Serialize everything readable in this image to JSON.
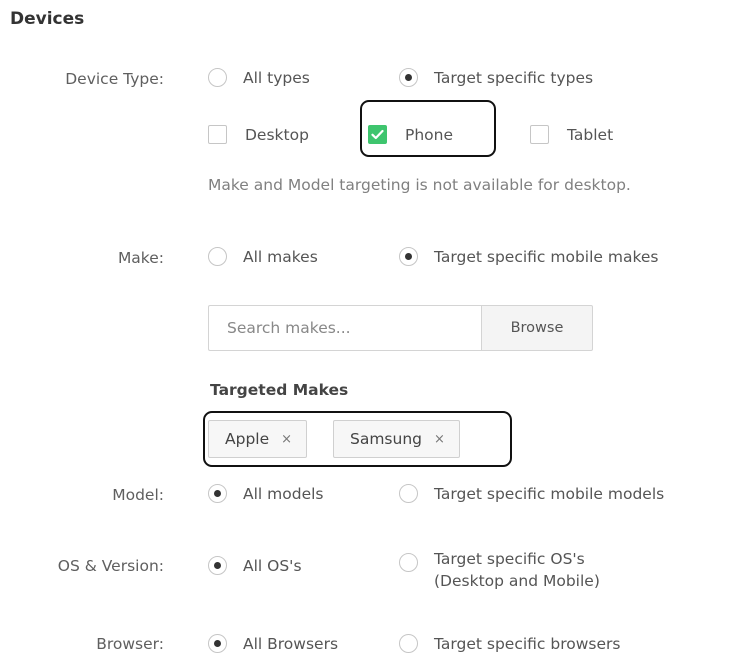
{
  "section_title": "Devices",
  "device_type": {
    "label": "Device Type:",
    "options": [
      "All types",
      "Target specific types"
    ],
    "selected": 1,
    "checkboxes": [
      {
        "label": "Desktop",
        "checked": false
      },
      {
        "label": "Phone",
        "checked": true
      },
      {
        "label": "Tablet",
        "checked": false
      }
    ],
    "note": "Make and Model targeting is not available for desktop."
  },
  "make": {
    "label": "Make:",
    "options": [
      "All makes",
      "Target specific mobile makes"
    ],
    "selected": 1,
    "search_placeholder": "Search makes...",
    "browse_label": "Browse",
    "targeted_title": "Targeted Makes",
    "targeted": [
      "Apple",
      "Samsung"
    ],
    "remove_symbol": "×"
  },
  "model": {
    "label": "Model:",
    "options": [
      "All models",
      "Target specific mobile models"
    ],
    "selected": 0
  },
  "os": {
    "label": "OS & Version:",
    "options": [
      "All OS's",
      "Target specific OS's",
      "(Desktop and Mobile)"
    ],
    "selected": 0
  },
  "browser": {
    "label": "Browser:",
    "options": [
      "All Browsers",
      "Target specific browsers"
    ],
    "selected": 0
  },
  "colors": {
    "accent_check": "#3ec56e",
    "highlight_border": "#111111"
  }
}
